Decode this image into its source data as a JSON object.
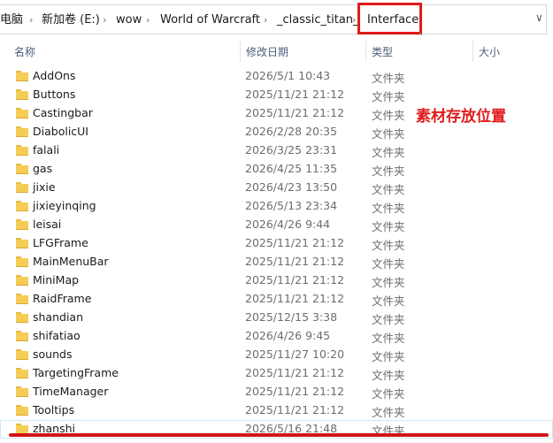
{
  "address_bar": {
    "crumbs": [
      "电脑",
      "新加卷 (E:)",
      "wow",
      "World of Warcraft",
      "_classic_titan_",
      "Interface"
    ],
    "dropdown_glyph": "∨"
  },
  "columns": {
    "name": "名称",
    "date": "修改日期",
    "type": "类型",
    "size": "大小"
  },
  "annotation": {
    "text": "素材存放位置",
    "color": "#e01b1b"
  },
  "files": [
    {
      "name": "AddOns",
      "date": "2026/5/1 10:43",
      "type": "文件夹"
    },
    {
      "name": "Buttons",
      "date": "2025/11/21 21:12",
      "type": "文件夹"
    },
    {
      "name": "Castingbar",
      "date": "2025/11/21 21:12",
      "type": "文件夹"
    },
    {
      "name": "DiabolicUI",
      "date": "2026/2/28 20:35",
      "type": "文件夹"
    },
    {
      "name": "falali",
      "date": "2026/3/25 23:31",
      "type": "文件夹"
    },
    {
      "name": "gas",
      "date": "2026/4/25 11:35",
      "type": "文件夹"
    },
    {
      "name": "jixie",
      "date": "2026/4/23 13:50",
      "type": "文件夹"
    },
    {
      "name": "jixieyinqing",
      "date": "2026/5/13 23:34",
      "type": "文件夹"
    },
    {
      "name": "leisai",
      "date": "2026/4/26 9:44",
      "type": "文件夹"
    },
    {
      "name": "LFGFrame",
      "date": "2025/11/21 21:12",
      "type": "文件夹"
    },
    {
      "name": "MainMenuBar",
      "date": "2025/11/21 21:12",
      "type": "文件夹"
    },
    {
      "name": "MiniMap",
      "date": "2025/11/21 21:12",
      "type": "文件夹"
    },
    {
      "name": "RaidFrame",
      "date": "2025/11/21 21:12",
      "type": "文件夹"
    },
    {
      "name": "shandian",
      "date": "2025/12/15 3:38",
      "type": "文件夹"
    },
    {
      "name": "shifatiao",
      "date": "2026/4/26 9:45",
      "type": "文件夹"
    },
    {
      "name": "sounds",
      "date": "2025/11/27 10:20",
      "type": "文件夹"
    },
    {
      "name": "TargetingFrame",
      "date": "2025/11/21 21:12",
      "type": "文件夹"
    },
    {
      "name": "TimeManager",
      "date": "2025/11/21 21:12",
      "type": "文件夹"
    },
    {
      "name": "Tooltips",
      "date": "2025/11/21 21:12",
      "type": "文件夹"
    },
    {
      "name": "zhanshi",
      "date": "2026/5/16 21:48",
      "type": "文件夹"
    }
  ],
  "selected_index": 19
}
